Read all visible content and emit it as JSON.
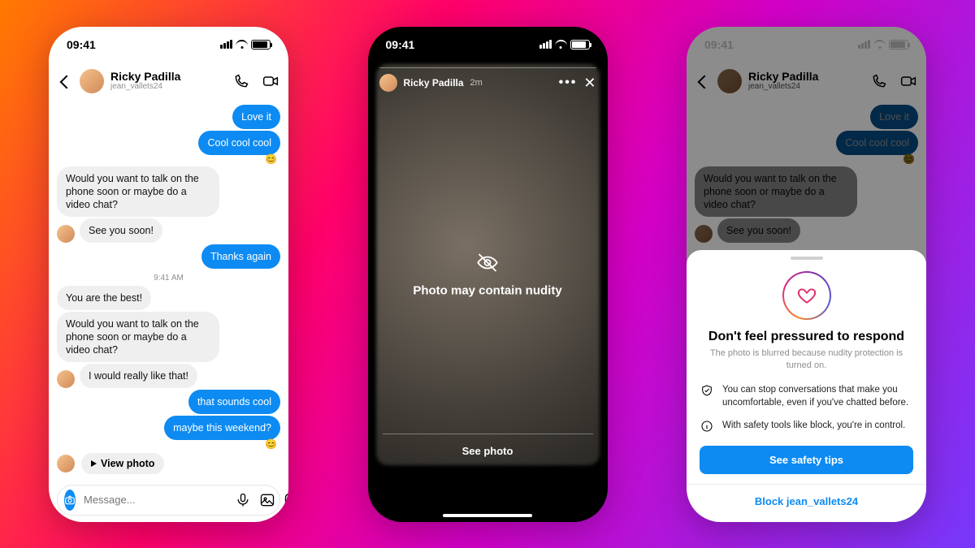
{
  "status_time": "09:41",
  "contact": {
    "name": "Ricky Padilla",
    "handle": "jean_vallets24"
  },
  "chat": {
    "messages": [
      {
        "side": "out",
        "text": "Love it"
      },
      {
        "side": "out",
        "text": "Cool cool cool",
        "reaction": "😊"
      },
      {
        "side": "in",
        "text": "Would you want to talk on the phone soon or maybe do a video chat?"
      },
      {
        "side": "in",
        "text": "See you soon!",
        "avatar": true
      },
      {
        "side": "out",
        "text": "Thanks again"
      }
    ],
    "timestamp": "9:41 AM",
    "messages2": [
      {
        "side": "in",
        "text": "You are the best!"
      },
      {
        "side": "in",
        "text": "Would you want to talk on the phone soon or maybe do a video chat?"
      },
      {
        "side": "in",
        "text": "I would really like that!",
        "avatar": true
      },
      {
        "side": "out",
        "text": "that sounds cool"
      },
      {
        "side": "out",
        "text": "maybe this weekend?",
        "reaction": "😊"
      }
    ],
    "view_photo_label": "View photo",
    "composer_placeholder": "Message..."
  },
  "story": {
    "name": "Ricky Padilla",
    "age": "2m",
    "warning": "Photo may contain nudity",
    "cta": "See photo"
  },
  "sheet": {
    "title": "Don't feel pressured to respond",
    "subtitle": "The photo is blurred because nudity protection is turned on.",
    "tips": [
      "You can stop conversations that make you uncomfortable, even if you've chatted before.",
      "With safety tools like block, you're in control."
    ],
    "primary": "See safety tips",
    "link": "Block jean_vallets24"
  }
}
